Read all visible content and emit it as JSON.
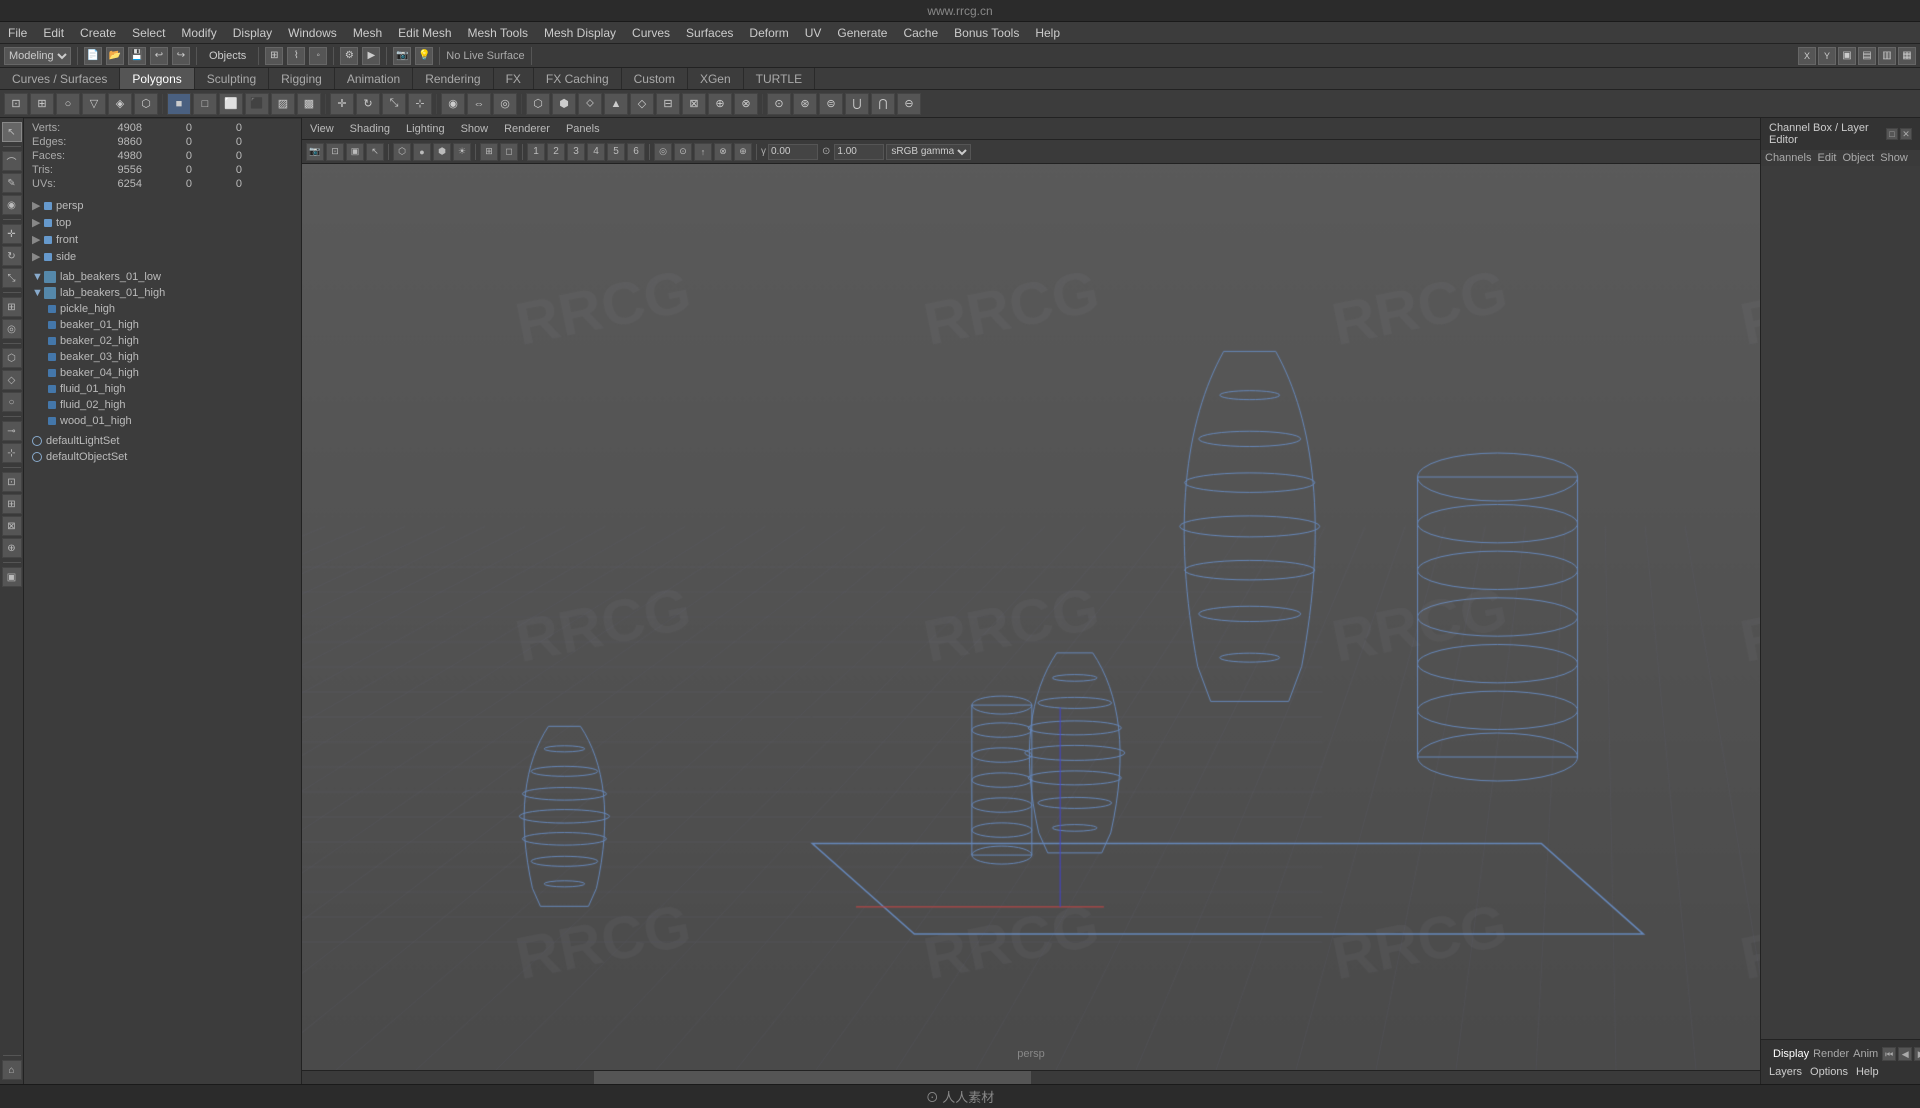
{
  "app": {
    "title": "www.rrcg.cn",
    "mode": "Modeling",
    "objects_label": "Objects"
  },
  "menu": {
    "items": [
      "File",
      "Edit",
      "Create",
      "Select",
      "Modify",
      "Display",
      "Windows",
      "Mesh",
      "Edit Mesh",
      "Mesh Tools",
      "Mesh Display",
      "Curves",
      "Surfaces",
      "Deform",
      "UV",
      "Generate",
      "Cache",
      "Bonus Tools",
      "Help"
    ]
  },
  "tabs": {
    "items": [
      "Curves / Surfaces",
      "Polygons",
      "Sculpting",
      "Rigging",
      "Animation",
      "Rendering",
      "FX",
      "FX Caching",
      "Custom",
      "XGen",
      "TURTLE"
    ],
    "active": "Polygons"
  },
  "viewport_menu": {
    "items": [
      "View",
      "Shading",
      "Lighting",
      "Show",
      "Renderer",
      "Panels"
    ]
  },
  "stats": {
    "verts_label": "Verts:",
    "verts_val": "4908",
    "verts_sel": "0",
    "verts_total": "0",
    "edges_label": "Edges:",
    "edges_val": "9860",
    "edges_sel": "0",
    "edges_total": "0",
    "faces_label": "Faces:",
    "faces_val": "4980",
    "faces_sel": "0",
    "faces_total": "0",
    "tris_label": "Tris:",
    "tris_val": "9556",
    "tris_sel": "0",
    "tris_total": "0",
    "uvs_label": "UVs:",
    "uvs_val": "6254",
    "uvs_sel": "0",
    "uvs_total": "0"
  },
  "outliner": {
    "items": [
      {
        "id": "persp",
        "type": "camera",
        "label": "persp",
        "indent": 0,
        "expanded": false
      },
      {
        "id": "top",
        "type": "camera",
        "label": "top",
        "indent": 0,
        "expanded": false
      },
      {
        "id": "front",
        "type": "camera",
        "label": "front",
        "indent": 0,
        "expanded": false
      },
      {
        "id": "side",
        "type": "camera",
        "label": "side",
        "indent": 0,
        "expanded": false
      },
      {
        "id": "lab_beakers_01_low",
        "type": "mesh",
        "label": "lab_beakers_01_low",
        "indent": 0,
        "expanded": true
      },
      {
        "id": "lab_beakers_01_high",
        "type": "mesh",
        "label": "lab_beakers_01_high",
        "indent": 0,
        "expanded": true
      },
      {
        "id": "pickle_high",
        "type": "mesh-child",
        "label": "pickle_high",
        "indent": 1,
        "expanded": false
      },
      {
        "id": "beaker_01_high",
        "type": "mesh-child",
        "label": "beaker_01_high",
        "indent": 1,
        "expanded": false
      },
      {
        "id": "beaker_02_high",
        "type": "mesh-child",
        "label": "beaker_02_high",
        "indent": 1,
        "expanded": false
      },
      {
        "id": "beaker_03_high",
        "type": "mesh-child",
        "label": "beaker_03_high",
        "indent": 1,
        "expanded": false
      },
      {
        "id": "beaker_04_high",
        "type": "mesh-child",
        "label": "beaker_04_high",
        "indent": 1,
        "expanded": false
      },
      {
        "id": "fluid_01_high",
        "type": "mesh-child",
        "label": "fluid_01_high",
        "indent": 1,
        "expanded": false
      },
      {
        "id": "fluid_02_high",
        "type": "mesh-child",
        "label": "fluid_02_high",
        "indent": 1,
        "expanded": false
      },
      {
        "id": "wood_01_high",
        "type": "mesh-child",
        "label": "wood_01_high",
        "indent": 1,
        "expanded": false
      },
      {
        "id": "defaultLightSet",
        "type": "set",
        "label": "defaultLightSet",
        "indent": 0,
        "expanded": false
      },
      {
        "id": "defaultObjectSet",
        "type": "set",
        "label": "defaultObjectSet",
        "indent": 0,
        "expanded": false
      }
    ]
  },
  "channel_box": {
    "title": "Channel Box / Layer Editor",
    "sub_items": [
      "Channels",
      "Edit",
      "Object",
      "Show"
    ]
  },
  "layer_editor": {
    "tabs": [
      "Display",
      "Render",
      "Anim"
    ],
    "active": "Display",
    "sub_tabs": [
      "Layers",
      "Options",
      "Help"
    ]
  },
  "viewport": {
    "label": "persp",
    "gamma_value": "0.00",
    "exposure_value": "1.00",
    "colorspace": "sRGB gamma",
    "no_live_surface": "No Live Surface"
  },
  "bottom_bar": {
    "logo": "⊙ 人人素材"
  }
}
